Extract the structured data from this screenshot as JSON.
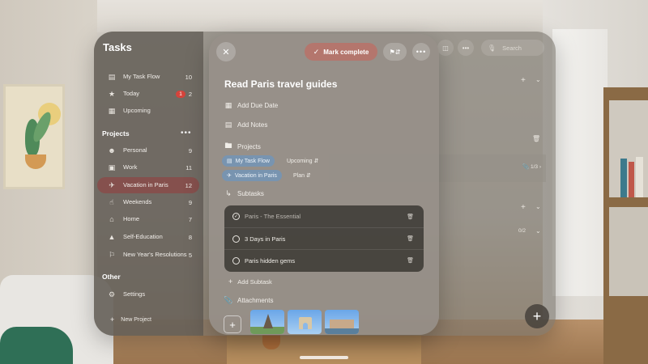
{
  "app": {
    "title": "Tasks"
  },
  "sidebar": {
    "items": [
      {
        "icon": "inbox-icon",
        "label": "My Task Flow",
        "count": "10"
      },
      {
        "icon": "star-icon",
        "label": "Today",
        "badge": "1",
        "count": "2"
      },
      {
        "icon": "calendar-icon",
        "label": "Upcoming",
        "count": ""
      }
    ],
    "projects_heading": "Projects",
    "projects_more": "•••",
    "projects": [
      {
        "icon": "person-icon",
        "label": "Personal",
        "count": "9"
      },
      {
        "icon": "briefcase-icon",
        "label": "Work",
        "count": "11"
      },
      {
        "icon": "airplane-icon",
        "label": "Vacation in Paris",
        "count": "12",
        "active": true
      },
      {
        "icon": "thumbs-up-icon",
        "label": "Weekends",
        "count": "9"
      },
      {
        "icon": "house-icon",
        "label": "Home",
        "count": "7"
      },
      {
        "icon": "graduation-cap-icon",
        "label": "Self-Education",
        "count": "8"
      },
      {
        "icon": "flag-icon",
        "label": "New Year's Resolutions",
        "count": "5"
      }
    ],
    "other_heading": "Other",
    "settings_label": "Settings",
    "new_project_label": "New Project"
  },
  "toolbar": {
    "search_placeholder": "Search"
  },
  "list": {
    "highlight_meta": "1/3",
    "row_meta": "0/2"
  },
  "detail": {
    "mark_complete_label": "Mark complete",
    "task_title": "Read Paris travel guides",
    "add_due_date_label": "Add Due Date",
    "add_notes_label": "Add Notes",
    "projects_label": "Projects",
    "project_chips": [
      {
        "label": "My Task Flow",
        "sub": "Upcoming"
      },
      {
        "label": "Vacation in Paris",
        "sub": "Plan"
      }
    ],
    "subtasks_label": "Subtasks",
    "subtasks": [
      {
        "label": "Paris - The Essential",
        "done": true
      },
      {
        "label": "3 Days in Paris",
        "done": false
      },
      {
        "label": "Paris hidden gems",
        "done": false
      }
    ],
    "add_subtask_label": "Add Subtask",
    "attachments_label": "Attachments"
  },
  "colors": {
    "active_project": "#8c4846",
    "badge": "#d4443c",
    "mark_complete": "#be6e64",
    "chip_blue": "#6e96be"
  }
}
